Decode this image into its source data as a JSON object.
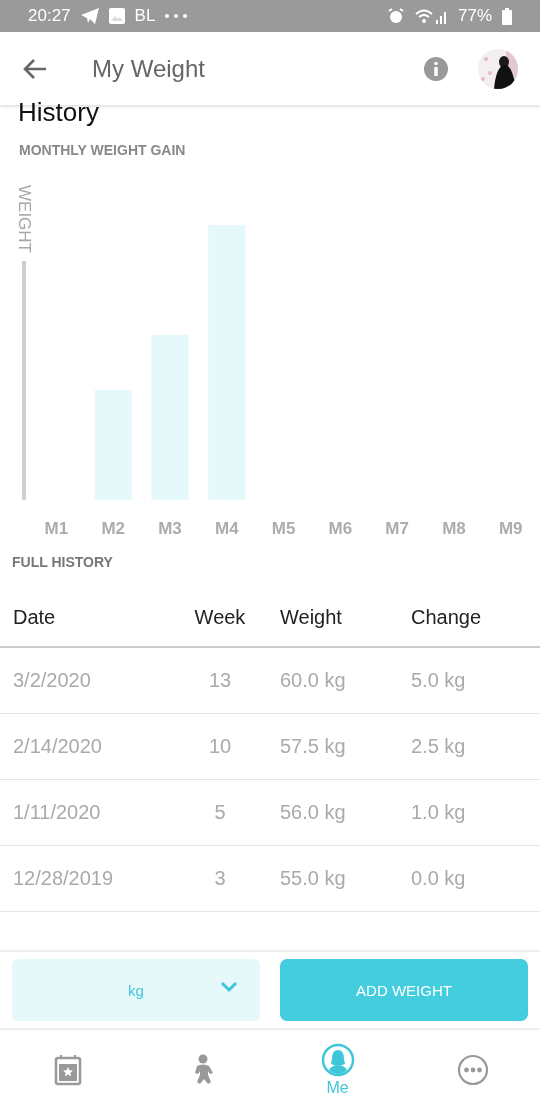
{
  "status_bar": {
    "time": "20:27",
    "carrier": "BL",
    "battery": "77%"
  },
  "header": {
    "title": "My Weight"
  },
  "section_title": "History",
  "chart": {
    "title": "MONTHLY WEIGHT GAIN",
    "axis_label": "WEIGHT",
    "month_labels": [
      "M1",
      "M2",
      "M3",
      "M4",
      "M5",
      "M6",
      "M7",
      "M8",
      "M9"
    ]
  },
  "full_history": {
    "title": "FULL HISTORY",
    "columns": [
      "Date",
      "Week",
      "Weight",
      "Change"
    ],
    "rows": [
      [
        "3/2/2020",
        "13",
        "60.0 kg",
        "5.0 kg"
      ],
      [
        "2/14/2020",
        "10",
        "57.5 kg",
        "2.5 kg"
      ],
      [
        "1/11/2020",
        "5",
        "56.0 kg",
        "1.0 kg"
      ],
      [
        "12/28/2019",
        "3",
        "55.0 kg",
        "0.0 kg"
      ]
    ]
  },
  "unit_select": {
    "value": "kg"
  },
  "add_button": "ADD WEIGHT",
  "bottom_nav": [
    {
      "kind": "calendar",
      "selected": false
    },
    {
      "kind": "baby",
      "selected": false
    },
    {
      "kind": "me",
      "label": "Me",
      "selected": true
    },
    {
      "kind": "more",
      "selected": false
    }
  ]
}
